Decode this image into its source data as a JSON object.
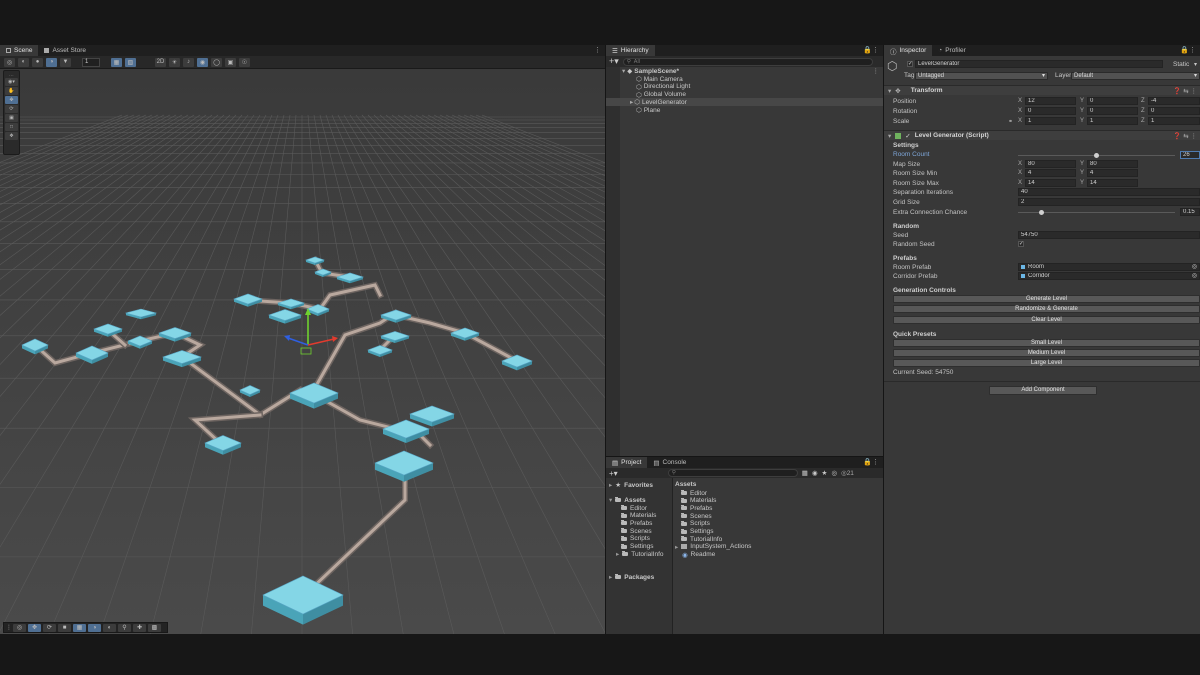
{
  "scene": {
    "tabs": [
      "Scene",
      "Asset Store"
    ],
    "grid_value": "1",
    "tools": [
      "hand-tool",
      "move-tool",
      "rotate-tool",
      "scale-tool",
      "rect-tool",
      "transform-tool"
    ]
  },
  "hierarchy": {
    "tab": "Hierarchy",
    "search_placeholder": "All",
    "scene_name": "SampleScene*",
    "items": [
      "Main Camera",
      "Directional Light",
      "Global Volume",
      "LevelGenerator",
      "Plane"
    ],
    "selected": "LevelGenerator"
  },
  "project": {
    "tabs": [
      "Project",
      "Console"
    ],
    "favorites": "Favorites",
    "assets": "Assets",
    "tree_folders": [
      "Editor",
      "Materials",
      "Prefabs",
      "Scenes",
      "Scripts",
      "Settings",
      "TutorialInfo"
    ],
    "packages": "Packages",
    "list_header": "Assets",
    "list_items": [
      "Editor",
      "Materials",
      "Prefabs",
      "Scenes",
      "Scripts",
      "Settings",
      "TutorialInfo",
      "InputSystem_Actions",
      "Readme"
    ],
    "count": "21"
  },
  "inspector": {
    "tabs": [
      "Inspector",
      "Profiler"
    ],
    "object_name": "LevelGenerator",
    "static_label": "Static",
    "tag_label": "Tag",
    "tag_value": "Untagged",
    "layer_label": "Layer",
    "layer_value": "Default",
    "transform": {
      "title": "Transform",
      "position": {
        "label": "Position",
        "x": "12",
        "y": "0",
        "z": "-4"
      },
      "rotation": {
        "label": "Rotation",
        "x": "0",
        "y": "0",
        "z": "0"
      },
      "scale": {
        "label": "Scale",
        "x": "1",
        "y": "1",
        "z": "1"
      }
    },
    "script": {
      "title": "Level Generator (Script)",
      "settings_header": "Settings",
      "room_count": {
        "label": "Room Count",
        "value": "26",
        "fraction": 0.5
      },
      "map_size": {
        "label": "Map Size",
        "x": "80",
        "y": "80"
      },
      "room_size_min": {
        "label": "Room Size Min",
        "x": "4",
        "y": "4"
      },
      "room_size_max": {
        "label": "Room Size Max",
        "x": "14",
        "y": "14"
      },
      "separation_iterations": {
        "label": "Separation Iterations",
        "value": "40"
      },
      "grid_size": {
        "label": "Grid Size",
        "value": "2"
      },
      "extra_connection_chance": {
        "label": "Extra Connection Chance",
        "value": "0.15",
        "fraction": 0.15
      },
      "random_header": "Random",
      "seed": {
        "label": "Seed",
        "value": "54750"
      },
      "random_seed": {
        "label": "Random Seed",
        "checked": true
      },
      "prefabs_header": "Prefabs",
      "room_prefab": {
        "label": "Room Prefab",
        "value": "Room"
      },
      "corridor_prefab": {
        "label": "Corridor Prefab",
        "value": "Corridor"
      },
      "generation_header": "Generation Controls",
      "generate_button": "Generate Level",
      "randomize_button": "Randomize & Generate",
      "clear_button": "Clear Level",
      "presets_header": "Quick Presets",
      "small_button": "Small Level",
      "medium_button": "Medium Level",
      "large_button": "Large Level",
      "current_seed": "Current Seed: 54750"
    },
    "add_component": "Add Component"
  },
  "colors": {
    "room_top": "#84d6e6",
    "room_side": "#4aa4b8",
    "corridor": "#b8a8a0",
    "accent": "#4f6f93"
  }
}
